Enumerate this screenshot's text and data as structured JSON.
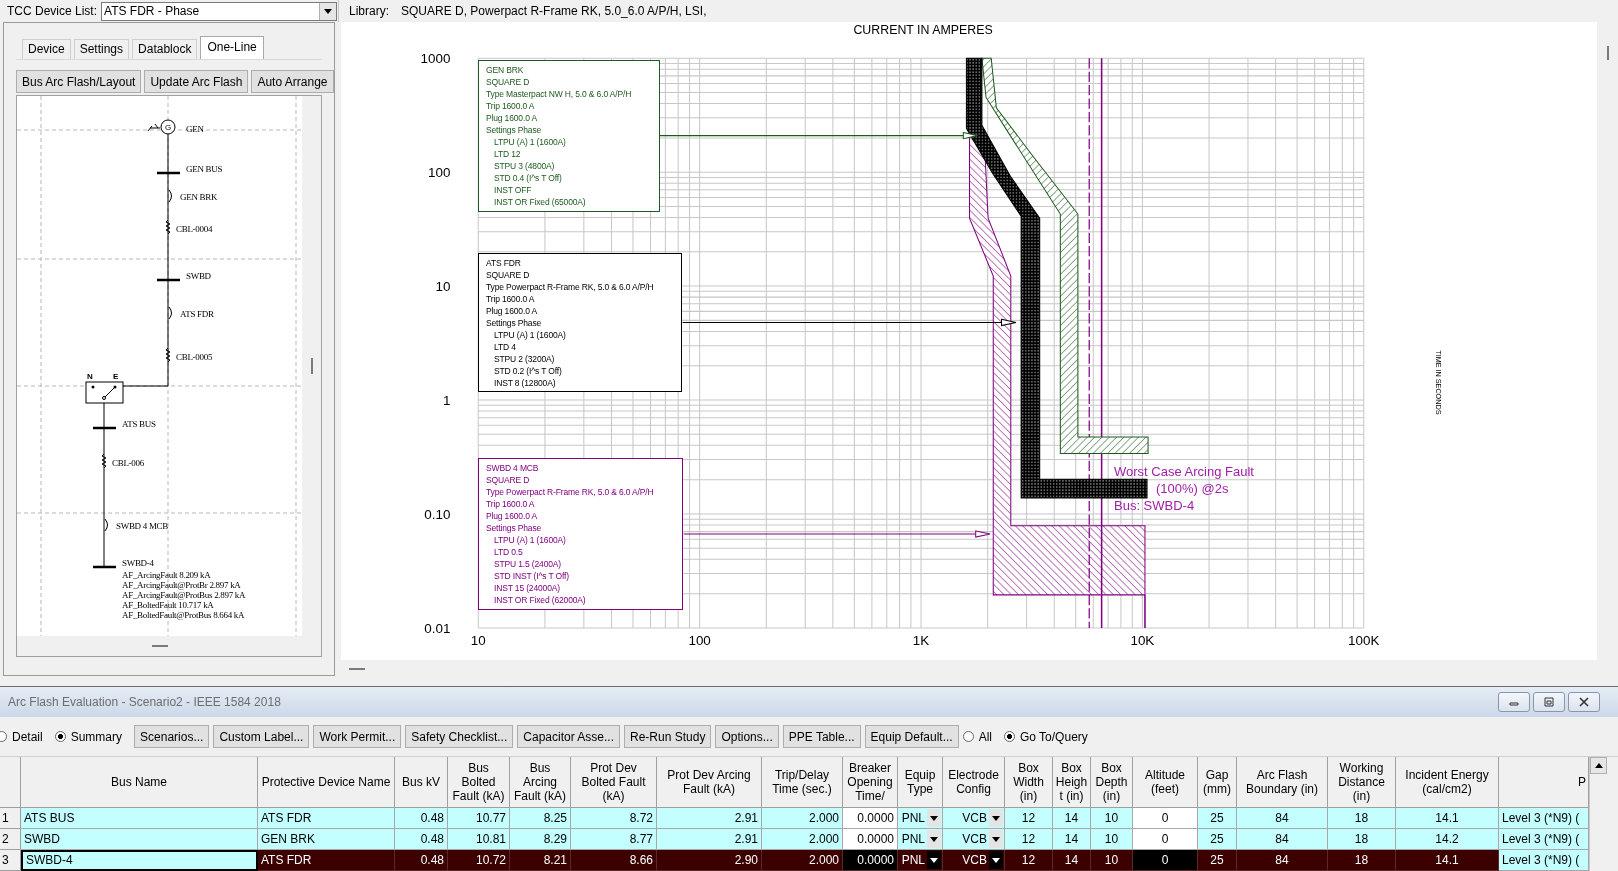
{
  "tcc_device_list": {
    "label": "TCC Device List:",
    "value": "ATS FDR - Phase"
  },
  "library": {
    "label": "Library:",
    "value": "SQUARE D, Powerpact R-Frame RK, 5.0_6.0 A/P/H, LSI,"
  },
  "side_panel": {
    "tabs": [
      {
        "label": "Device",
        "selected": false
      },
      {
        "label": "Settings",
        "selected": false
      },
      {
        "label": "Datablock",
        "selected": false
      },
      {
        "label": "One-Line",
        "selected": true
      }
    ],
    "buttons": [
      "Bus Arc Flash/Layout",
      "Update Arc Flash",
      "Auto Arrange"
    ],
    "one_line": {
      "nodes": [
        {
          "kind": "generator",
          "symbol": "G",
          "label": "GEN"
        },
        {
          "kind": "bus",
          "label": "GEN BUS"
        },
        {
          "kind": "breaker",
          "label": "GEN BRK"
        },
        {
          "kind": "cable",
          "label": "CBL-0004"
        },
        {
          "kind": "bus",
          "label": "SWBD"
        },
        {
          "kind": "breaker",
          "label": "ATS FDR"
        },
        {
          "kind": "cable",
          "label": "CBL-0005"
        },
        {
          "kind": "transfer_switch",
          "labels": [
            "N",
            "E"
          ]
        },
        {
          "kind": "bus",
          "label": "ATS BUS"
        },
        {
          "kind": "cable",
          "label": "CBL-006"
        },
        {
          "kind": "breaker",
          "label": "SWBD 4 MCB"
        },
        {
          "kind": "bus",
          "label": "SWBD-4",
          "results": [
            "AF_ArcingFault 8.209 kA",
            "AF_ArcingFault@ProtBr 2.897 kA",
            "AF_ArcingFault@ProtBus 2.897 kA",
            "AF_BoltedFault 10.717 kA",
            "AF_BoltedFault@ProtBus 8.664 kA"
          ]
        }
      ]
    }
  },
  "chart": {
    "title": "CURRENT IN AMPERES",
    "y_axis_title": "TIME IN SECONDS",
    "x_ticks": [
      "10",
      "100",
      "1K",
      "10K",
      "100K"
    ],
    "y_ticks": [
      "1000",
      "100",
      "10",
      "1",
      "0.10",
      "0.01"
    ],
    "devices": [
      {
        "kind": "hatched_band",
        "color": "#1e5a1e",
        "lines": [
          "GEN BRK",
          "SQUARE D",
          "Type Masterpact NW H, 5.0 & 6.0 A/P/H",
          "Trip 1600.0 A",
          "Plug 1600.0 A"
        ],
        "settings_title": "Settings Phase",
        "settings": [
          "LTPU (A) 1 (1600A)",
          "LTD 12",
          "STPU 3 (4800A)",
          "STD 0.4 (I^s T Off)",
          "INST OFF",
          "INST OR Fixed (65000A)"
        ]
      },
      {
        "kind": "dotted_band",
        "color": "#000000",
        "lines": [
          "ATS FDR",
          "SQUARE D",
          "Type Powerpact R-Frame RK, 5.0 & 6.0 A/P/H",
          "Trip 1600.0 A",
          "Plug 1600.0 A"
        ],
        "settings_title": "Settings Phase",
        "settings": [
          "LTPU (A) 1 (1600A)",
          "LTD 4",
          "STPU 2 (3200A)",
          "STD 0.2 (I^s T Off)",
          "INST 8 (12800A)"
        ]
      },
      {
        "kind": "hatched_band",
        "color": "#800080",
        "lines": [
          "SWBD 4 MCB",
          "SQUARE D",
          "Type Powerpact R-Frame RK, 5.0 & 6.0 A/P/H",
          "Trip 1600.0 A",
          "Plug 1600.0 A"
        ],
        "settings_title": "Settings Phase",
        "settings": [
          "LTPU (A) 1 (1600A)",
          "LTD 0.5",
          "STPU 1.5 (2400A)",
          "STD INST (I^s T Off)",
          "INST 15 (24000A)",
          "INST OR Fixed (62000A)"
        ]
      }
    ],
    "annotation": [
      "Worst Case Arcing Fault",
      "(100%) @2s",
      "Bus: SWBD-4"
    ]
  },
  "arc_flash_window": {
    "title": "Arc Flash Evaluation - Scenario2 - IEEE 1584 2018",
    "toolbar": [
      {
        "kind": "radio",
        "label": "Detail",
        "selected": false
      },
      {
        "kind": "radio",
        "label": "Summary",
        "selected": true
      },
      {
        "kind": "button",
        "label": "Scenarios..."
      },
      {
        "kind": "button",
        "label": "Custom Label..."
      },
      {
        "kind": "button",
        "label": "Work Permit..."
      },
      {
        "kind": "button",
        "label": "Safety Checklist..."
      },
      {
        "kind": "button",
        "label": "Capacitor Asse..."
      },
      {
        "kind": "button",
        "label": "Re-Run Study"
      },
      {
        "kind": "button",
        "label": "Options..."
      },
      {
        "kind": "button",
        "label": "PPE Table..."
      },
      {
        "kind": "button",
        "label": "Equip Default..."
      },
      {
        "kind": "radio",
        "label": "All",
        "selected": false
      },
      {
        "kind": "radio",
        "label": "Go To/Query",
        "selected": true
      }
    ],
    "table": {
      "columns": [
        {
          "label": "Bus Name",
          "kind": "key"
        },
        {
          "label": "Protective Device Name",
          "kind": "text"
        },
        {
          "label": "Bus kV",
          "kind": "number"
        },
        {
          "label": "Bus Bolted Fault (kA)",
          "kind": "number"
        },
        {
          "label": "Bus Arcing Fault (kA)",
          "kind": "number"
        },
        {
          "label": "Prot Dev Bolted Fault (kA)",
          "kind": "number"
        },
        {
          "label": "Prot Dev Arcing Fault (kA)",
          "kind": "number"
        },
        {
          "label": "Trip/Delay Time (sec.)",
          "kind": "number"
        },
        {
          "label": "Breaker Opening Time/",
          "kind": "editable"
        },
        {
          "label": "Equip Type",
          "kind": "dropdown"
        },
        {
          "label": "Electrode Config",
          "kind": "dropdown"
        },
        {
          "label": "Box Width (in)",
          "kind": "center"
        },
        {
          "label": "Box Height (in)",
          "kind": "center"
        },
        {
          "label": "Box Depth (in)",
          "kind": "center"
        },
        {
          "label": "Altitude (feet)",
          "kind": "editable_center"
        },
        {
          "label": "Gap (mm)",
          "kind": "center"
        },
        {
          "label": "Arc Flash Boundary (in)",
          "kind": "center"
        },
        {
          "label": "Working Distance (in)",
          "kind": "center"
        },
        {
          "label": "Incident Energy (cal/cm2)",
          "kind": "center"
        },
        {
          "label": "P",
          "kind": "level"
        }
      ],
      "rows": [
        {
          "number": "1",
          "selected": false,
          "cells": [
            "ATS BUS",
            "ATS FDR",
            "0.48",
            "10.77",
            "8.25",
            "8.72",
            "2.91",
            "2.000",
            "0.0000",
            "PNL",
            "VCB",
            "12",
            "14",
            "10",
            "0",
            "25",
            "84",
            "18",
            "14.1",
            "Level 3 (*N9) ("
          ]
        },
        {
          "number": "2",
          "selected": false,
          "cells": [
            "SWBD",
            "GEN BRK",
            "0.48",
            "10.81",
            "8.29",
            "8.77",
            "2.91",
            "2.000",
            "0.0000",
            "PNL",
            "VCB",
            "12",
            "14",
            "10",
            "0",
            "25",
            "84",
            "18",
            "14.2",
            "Level 3 (*N9) ("
          ]
        },
        {
          "number": "3",
          "selected": true,
          "cells": [
            "SWBD-4",
            "ATS FDR",
            "0.48",
            "10.72",
            "8.21",
            "8.66",
            "2.90",
            "2.000",
            "0.0000",
            "PNL",
            "VCB",
            "12",
            "14",
            "10",
            "0",
            "25",
            "84",
            "18",
            "14.1",
            "Level 3 (*N9) ("
          ]
        }
      ]
    }
  }
}
